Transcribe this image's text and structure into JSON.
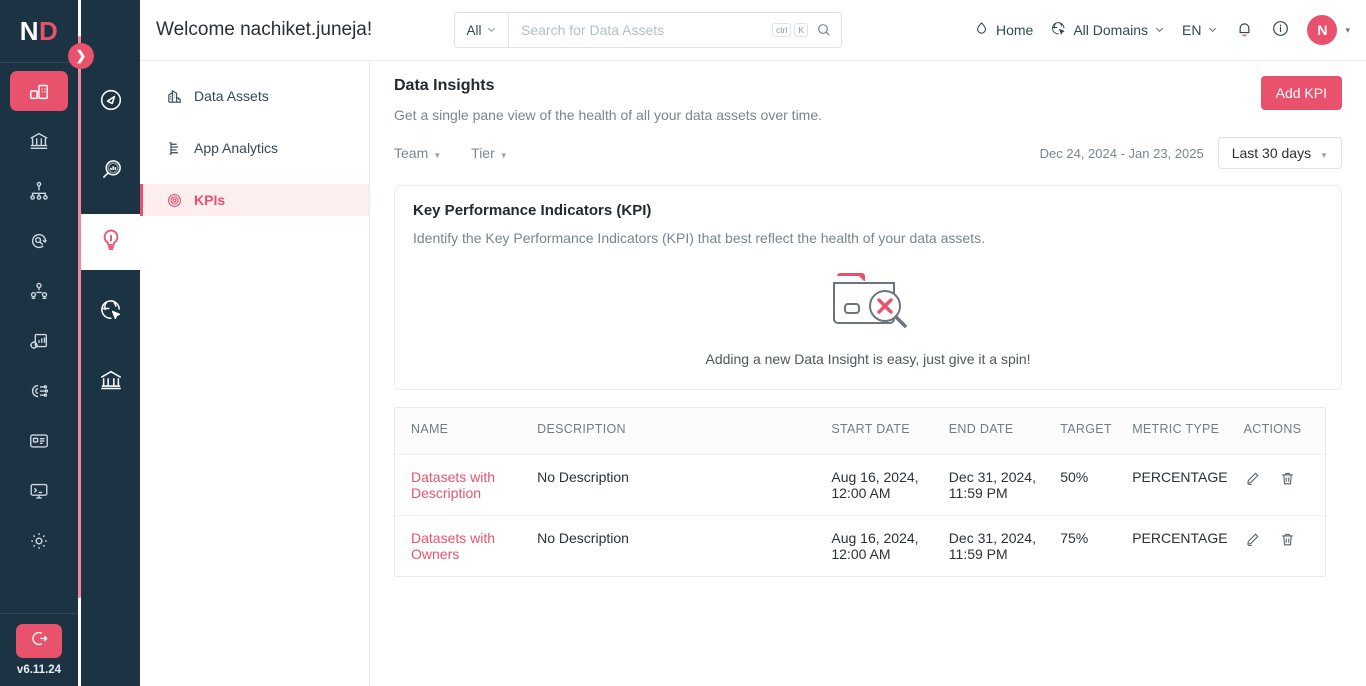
{
  "brand": {
    "logo_left": "ND",
    "logo_part1": "N",
    "logo_part2": "D",
    "accent": "#e8526d",
    "rail_bg": "#1c3344",
    "version": "v6.11.24"
  },
  "app_rail": {
    "items": [
      {
        "name": "insights",
        "icon": "dashboard-chart-icon",
        "active": true
      },
      {
        "name": "govern",
        "icon": "bank-icon",
        "active": false
      },
      {
        "name": "lineage",
        "icon": "hierarchy-icon",
        "active": false
      },
      {
        "name": "discovery",
        "icon": "search-refresh-icon",
        "active": false
      },
      {
        "name": "collaboration",
        "icon": "people-network-icon",
        "active": false
      },
      {
        "name": "observability",
        "icon": "gear-chart-icon",
        "active": false
      },
      {
        "name": "integrations",
        "icon": "plug-nodes-icon",
        "active": false
      },
      {
        "name": "glossary",
        "icon": "id-card-icon",
        "active": false
      },
      {
        "name": "console",
        "icon": "terminal-monitor-icon",
        "active": false
      },
      {
        "name": "settings",
        "icon": "gear-icon",
        "active": false
      }
    ],
    "logout_icon": "logout-icon",
    "expand_icon": "chevron-right-icon"
  },
  "icon_column": {
    "items": [
      {
        "name": "explore",
        "icon": "compass-icon",
        "active": false
      },
      {
        "name": "analytics",
        "icon": "magnifier-chart-icon",
        "active": false
      },
      {
        "name": "insights",
        "icon": "lightbulb-icon",
        "active": true
      },
      {
        "name": "domains",
        "icon": "globe-cursor-icon",
        "active": false
      },
      {
        "name": "governance",
        "icon": "bank-icon",
        "active": false
      }
    ]
  },
  "header": {
    "welcome": "Welcome nachiket.juneja!",
    "search": {
      "scope_label": "All",
      "placeholder": "Search for Data Assets",
      "value": "",
      "shortcut_ctrl": "ctrl",
      "shortcut_key": "K",
      "search_icon": "search-icon",
      "scope_caret_icon": "chevron-down-icon"
    },
    "home_label": "Home",
    "home_icon": "home-icon",
    "domains_label": "All Domains",
    "domains_icon": "globe-cursor-icon",
    "domains_caret_icon": "chevron-down-icon",
    "language_label": "EN",
    "language_caret_icon": "chevron-down-icon",
    "bell_icon": "notification-bell-icon",
    "info_icon": "info-circle-icon",
    "avatar_initial": "N",
    "avatar_caret_icon": "caret-down-icon"
  },
  "subnav": {
    "items": [
      {
        "label": "Data Assets",
        "icon": "data-assets-icon",
        "active": false
      },
      {
        "label": "App Analytics",
        "icon": "app-analytics-icon",
        "active": false
      },
      {
        "label": "KPIs",
        "icon": "kpi-target-icon",
        "active": true
      }
    ]
  },
  "main": {
    "title": "Data Insights",
    "subtitle": "Get a single pane view of the health of all your data assets over time.",
    "add_kpi_label": "Add KPI",
    "filters": [
      {
        "label": "Team",
        "name": "team-filter"
      },
      {
        "label": "Tier",
        "name": "tier-filter"
      }
    ],
    "date_range_text": "Dec 24, 2024 - Jan 23, 2025",
    "date_range_select": "Last 30 days",
    "kpi_card": {
      "title": "Key Performance Indicators (KPI)",
      "subtitle": "Identify the Key Performance Indicators (KPI) that best reflect the health of your data assets.",
      "empty_illustration": "folder-search-error-icon",
      "empty_text": "Adding a new Data Insight is easy, just give it a spin!"
    },
    "table": {
      "columns": [
        "NAME",
        "DESCRIPTION",
        "START DATE",
        "END DATE",
        "TARGET",
        "METRIC TYPE",
        "ACTIONS"
      ],
      "rows": [
        {
          "name": "Datasets with Description",
          "description": "No Description",
          "start_date": "Aug 16, 2024, 12:00 AM",
          "end_date": "Dec 31, 2024, 11:59 PM",
          "target": "50%",
          "metric_type": "PERCENTAGE",
          "edit_icon": "pencil-icon",
          "delete_icon": "trash-icon"
        },
        {
          "name": "Datasets with Owners",
          "description": "No Description",
          "start_date": "Aug 16, 2024, 12:00 AM",
          "end_date": "Dec 31, 2024, 11:59 PM",
          "target": "75%",
          "metric_type": "PERCENTAGE",
          "edit_icon": "pencil-icon",
          "delete_icon": "trash-icon"
        }
      ]
    }
  }
}
